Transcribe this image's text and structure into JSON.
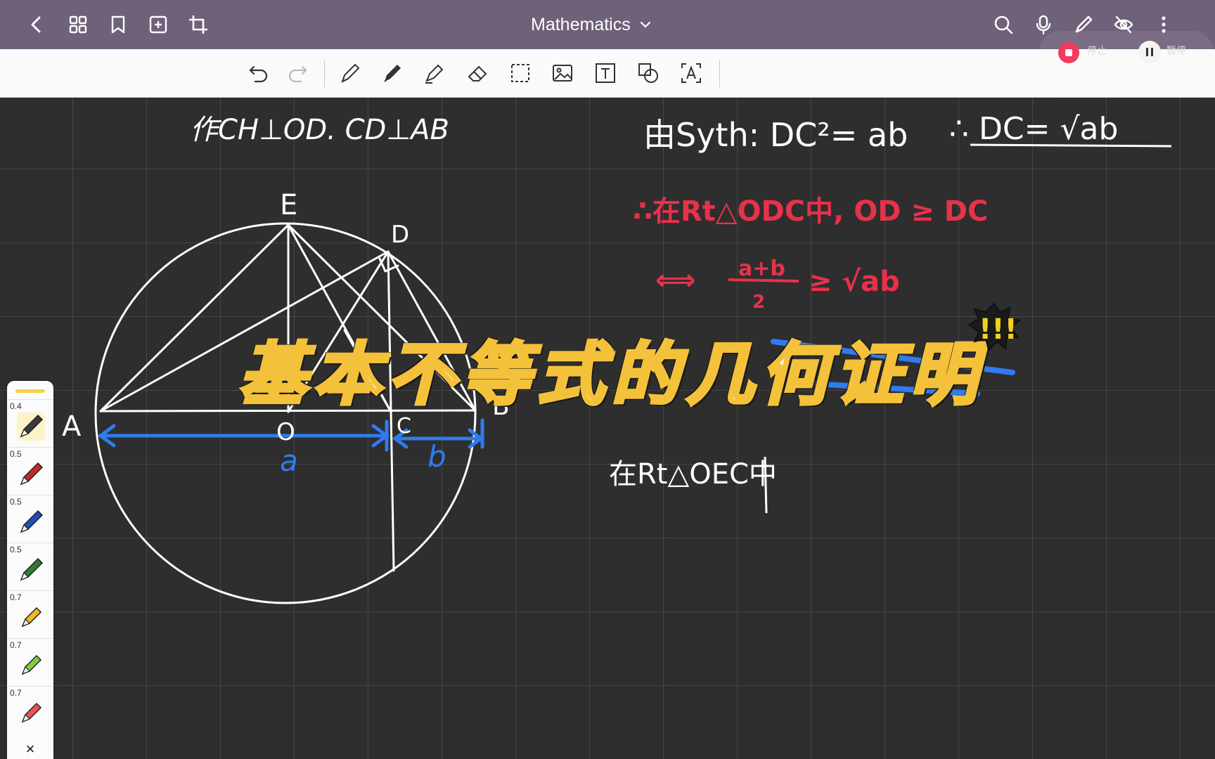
{
  "app": {
    "title": "Mathematics",
    "recording": {
      "stop_label": "停止",
      "pause_label": "暂停"
    }
  },
  "topbar_icons": [
    "back-icon",
    "grid-icon",
    "bookmark-icon",
    "add-page-icon",
    "crop-icon",
    "search-icon",
    "microphone-icon",
    "pen-mode-icon",
    "hide-icon",
    "more-icon"
  ],
  "toolbar_icons": [
    "undo-icon",
    "redo-icon",
    "fountain-pen-icon",
    "ballpoint-pen-icon",
    "highlighter-icon",
    "eraser-icon",
    "lasso-select-icon",
    "image-icon",
    "text-box-icon",
    "shapes-icon",
    "text-recognition-icon"
  ],
  "pen_panel": {
    "pens": [
      {
        "size": "0.4",
        "color": "#3a3a3a",
        "kind": "pen"
      },
      {
        "size": "0.5",
        "color": "#c62828",
        "kind": "pen"
      },
      {
        "size": "0.5",
        "color": "#1e4fb8",
        "kind": "pen"
      },
      {
        "size": "0.5",
        "color": "#2e7d32",
        "kind": "pen"
      },
      {
        "size": "0.7",
        "color": "#f2b824",
        "kind": "highlighter"
      },
      {
        "size": "0.7",
        "color": "#7ccf46",
        "kind": "highlighter"
      },
      {
        "size": "0.7",
        "color": "#ef5350",
        "kind": "highlighter"
      }
    ],
    "close_label": "×"
  },
  "colors": {
    "ink_white": "#ffffff",
    "ink_red": "#e8314a",
    "ink_blue": "#2f7bf0",
    "topbar": "#6f6179",
    "overlay_stroke": "#f4c23a"
  },
  "notes": {
    "construction": "作CH⊥OD. CD⊥AB",
    "formula": "由Syth: DC²= ab",
    "result": "∴ DC= √ab",
    "red_line1": "∴在Rt△ODC中, OD ≥ DC",
    "red_line2_prefix": "⟺",
    "red_fraction_num": "a+b",
    "red_fraction_den": "2",
    "red_line2_suffix": "≥ √ab",
    "lower_note": "在Rt△OEC中"
  },
  "geometry_labels": {
    "E": "E",
    "D": "D",
    "A": "A",
    "B": "B",
    "O": "O",
    "C": "C",
    "a": "a",
    "b": "b"
  },
  "overlay_title": "基本不等式的几何证明"
}
